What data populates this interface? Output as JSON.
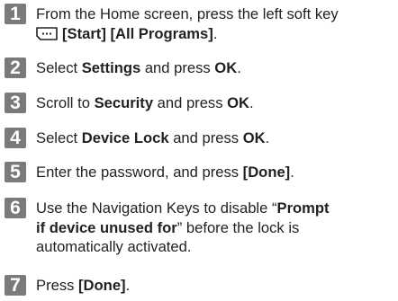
{
  "steps": [
    {
      "number": "1",
      "parts": [
        {
          "text": "From the Home screen, press the left soft key",
          "bold": false
        },
        {
          "text": "[Start] [All Programs]",
          "bold": true
        },
        {
          "text": ".",
          "bold": false
        }
      ],
      "icon": "softkey-icon"
    },
    {
      "number": "2",
      "parts": [
        {
          "text": "Select ",
          "bold": false
        },
        {
          "text": "Settings",
          "bold": true
        },
        {
          "text": " and press ",
          "bold": false
        },
        {
          "text": "OK",
          "bold": true
        },
        {
          "text": ".",
          "bold": false
        }
      ]
    },
    {
      "number": "3",
      "parts": [
        {
          "text": "Scroll to ",
          "bold": false
        },
        {
          "text": "Security",
          "bold": true
        },
        {
          "text": " and press ",
          "bold": false
        },
        {
          "text": "OK",
          "bold": true
        },
        {
          "text": ".",
          "bold": false
        }
      ]
    },
    {
      "number": "4",
      "parts": [
        {
          "text": "Select ",
          "bold": false
        },
        {
          "text": "Device Lock",
          "bold": true
        },
        {
          "text": " and press ",
          "bold": false
        },
        {
          "text": "OK",
          "bold": true
        },
        {
          "text": ".",
          "bold": false
        }
      ]
    },
    {
      "number": "5",
      "parts": [
        {
          "text": "Enter the password, and press ",
          "bold": false
        },
        {
          "text": "[Done]",
          "bold": true
        },
        {
          "text": ".",
          "bold": false
        }
      ]
    },
    {
      "number": "6",
      "parts": [
        {
          "text": "Use the Navigation Keys to disable “",
          "bold": false
        },
        {
          "text": "Prompt",
          "bold": true
        },
        {
          "text": "if device unused for",
          "bold": true
        },
        {
          "text": "” before the lock is",
          "bold": false
        },
        {
          "text": "automatically activated.",
          "bold": false
        }
      ]
    },
    {
      "number": "7",
      "parts": [
        {
          "text": "Press ",
          "bold": false
        },
        {
          "text": "[Done]",
          "bold": true
        },
        {
          "text": ".",
          "bold": false
        }
      ]
    }
  ]
}
